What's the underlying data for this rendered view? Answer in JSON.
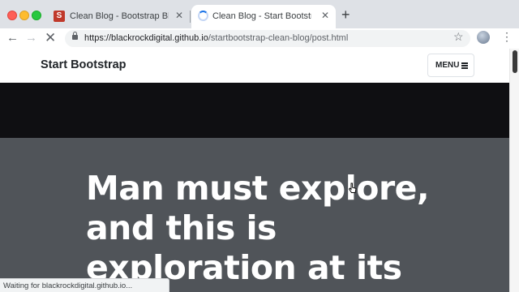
{
  "browser": {
    "tabs": [
      {
        "title": "Clean Blog - Bootstrap Blog Th",
        "favicon_letter": "S",
        "state": "inactive"
      },
      {
        "title": "Clean Blog - Start Bootstrap Th",
        "state": "loading"
      }
    ],
    "close_glyph": "✕",
    "new_tab_glyph": "+",
    "back_glyph": "←",
    "forward_glyph": "→",
    "stop_glyph": "✕",
    "url_host": "https://blackrockdigital.github.io",
    "url_path": "/startbootstrap-clean-blog/post.html",
    "bookmark_glyph": "☆",
    "menu_glyph": "⋮",
    "status_text": "Waiting for blackrockdigital.github.io..."
  },
  "site": {
    "brand": "Start Bootstrap",
    "menu_label": "MENU",
    "headline_lines": [
      "Man must explore,",
      "and this is",
      "exploration at its"
    ]
  },
  "colors": {
    "hero_bg": "#505459",
    "dark_band": "#0f0f12",
    "loading_accent": "#1a73e8"
  }
}
